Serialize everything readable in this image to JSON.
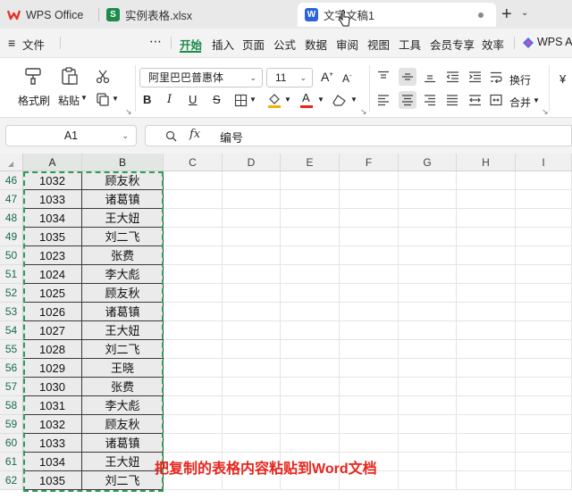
{
  "tabs": [
    {
      "label": "WPS Office",
      "logo_color": "#e8332c"
    },
    {
      "label": "实例表格.xlsx",
      "logo_letter": "S",
      "logo_color": "#1b8a4a"
    },
    {
      "label": "文字文稿1",
      "logo_letter": "W",
      "logo_color": "#2b63d9"
    }
  ],
  "menu": {
    "file": "文件",
    "items": [
      "开始",
      "插入",
      "页面",
      "公式",
      "数据",
      "审阅",
      "视图",
      "工具",
      "会员专享",
      "效率",
      "WPS AI"
    ]
  },
  "ribbon": {
    "format_painter": "格式刷",
    "paste": "粘贴",
    "font_name": "阿里巴巴普惠体",
    "font_size": "11",
    "wrap": "换行",
    "merge": "合并"
  },
  "formula_bar": {
    "cell_ref": "A1",
    "fx": "fx",
    "content": "编号"
  },
  "columns": [
    "A",
    "B",
    "C",
    "D",
    "E",
    "F",
    "G",
    "H",
    "I"
  ],
  "rows": [
    {
      "n": "46",
      "a": "1032",
      "b": "顾友秋"
    },
    {
      "n": "47",
      "a": "1033",
      "b": "诸葛镇"
    },
    {
      "n": "48",
      "a": "1034",
      "b": "王大妞"
    },
    {
      "n": "49",
      "a": "1035",
      "b": "刘二飞"
    },
    {
      "n": "50",
      "a": "1023",
      "b": "张费"
    },
    {
      "n": "51",
      "a": "1024",
      "b": "李大彪"
    },
    {
      "n": "52",
      "a": "1025",
      "b": "顾友秋"
    },
    {
      "n": "53",
      "a": "1026",
      "b": "诸葛镇"
    },
    {
      "n": "54",
      "a": "1027",
      "b": "王大妞"
    },
    {
      "n": "55",
      "a": "1028",
      "b": "刘二飞"
    },
    {
      "n": "56",
      "a": "1029",
      "b": "王晓"
    },
    {
      "n": "57",
      "a": "1030",
      "b": "张费"
    },
    {
      "n": "58",
      "a": "1031",
      "b": "李大彪"
    },
    {
      "n": "59",
      "a": "1032",
      "b": "顾友秋"
    },
    {
      "n": "60",
      "a": "1033",
      "b": "诸葛镇"
    },
    {
      "n": "61",
      "a": "1034",
      "b": "王大妞"
    },
    {
      "n": "62",
      "a": "1035",
      "b": "刘二飞"
    }
  ],
  "annotation": "把复制的表格内容粘贴到Word文档",
  "colors": {
    "accent": "#1b8a4a",
    "selection": "#2e9d55",
    "annotation": "#e8251d"
  }
}
